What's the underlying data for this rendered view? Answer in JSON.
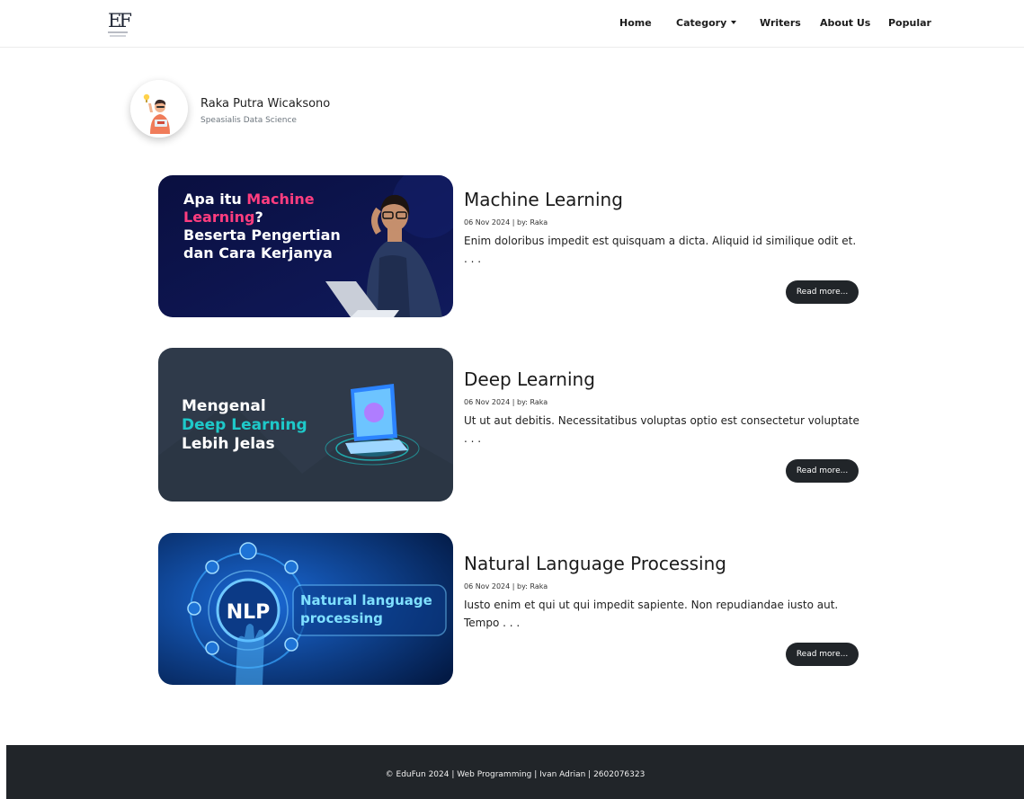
{
  "brand": {
    "logo_text": "EF"
  },
  "nav": {
    "home": "Home",
    "category": "Category",
    "writers": "Writers",
    "about": "About Us",
    "popular": "Popular"
  },
  "author": {
    "name": "Raka Putra Wicaksono",
    "role": "Speasialis Data Science"
  },
  "articles": [
    {
      "title": "Machine Learning",
      "meta": "06 Nov 2024 | by: Raka",
      "excerpt": "Enim doloribus impedit est quisquam a dicta. Aliquid id similique odit et. . . .",
      "read_more": "Read more...",
      "thumb": {
        "line1a": "Apa itu ",
        "line1b": "Machine",
        "line2a": "Learning",
        "line2b": "?",
        "line3": "Beserta Pengertian",
        "line4": "dan Cara Kerjanya"
      }
    },
    {
      "title": "Deep Learning",
      "meta": "06 Nov 2024 | by: Raka",
      "excerpt": "Ut ut aut debitis. Necessitatibus voluptas optio est consectetur voluptate . . .",
      "read_more": "Read more...",
      "thumb": {
        "line1": "Mengenal",
        "line2": "Deep Learning",
        "line3": "Lebih Jelas"
      }
    },
    {
      "title": "Natural Language Processing",
      "meta": "06 Nov 2024 | by: Raka",
      "excerpt": "Iusto enim et qui ut qui impedit sapiente. Non repudiandae iusto aut. Tempo . . .",
      "read_more": "Read more...",
      "thumb": {
        "badge": "NLP",
        "line1": "Natural language",
        "line2": "processing"
      }
    }
  ],
  "footer": {
    "text": "© EduFun 2024 | Web Programming | Ivan Adrian | 2602076323"
  },
  "colors": {
    "dark": "#212529",
    "ml_bg": "#0b1246",
    "ml_accent": "#ff3d7f",
    "dl_bg": "#2f3a4a",
    "dl_accent": "#1ec9c9",
    "nlp_bg": "#062a66"
  }
}
